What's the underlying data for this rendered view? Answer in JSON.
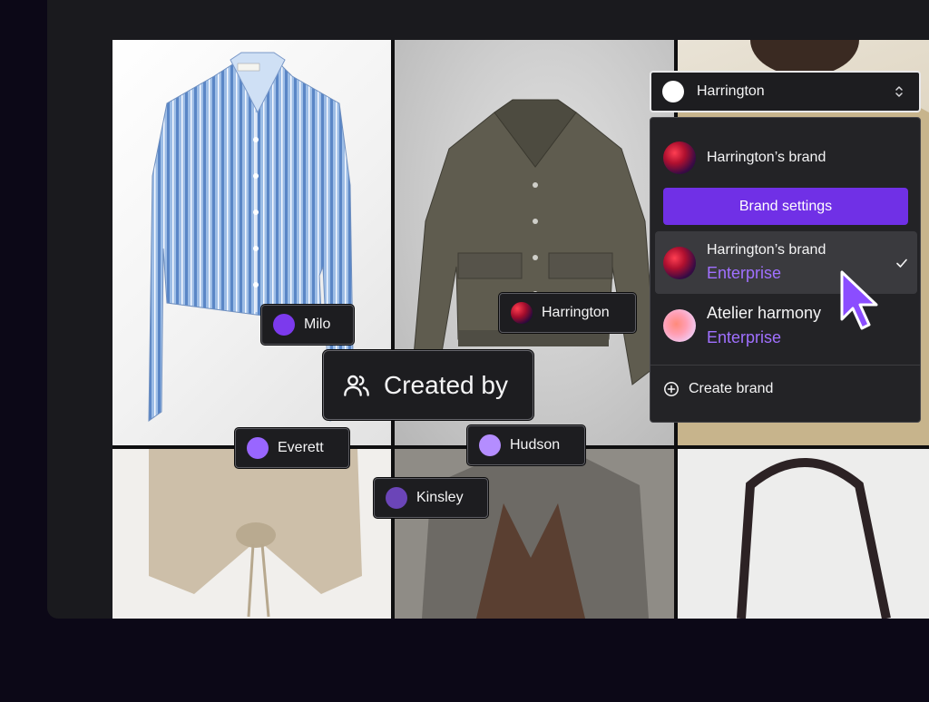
{
  "colors": {
    "accent": "#7030e6",
    "tier_text": "#a070ff",
    "chip_bg": "#1d1d20",
    "page_bg": "#0c0817"
  },
  "chips": [
    {
      "label": "Milo",
      "dot_color": "#7c3aed"
    },
    {
      "label": "Harrington",
      "avatar": "brand-avatar"
    },
    {
      "label": "Everett",
      "dot_color": "#9966ff"
    },
    {
      "label": "Hudson",
      "dot_color": "#b48dff"
    },
    {
      "label": "Kinsley",
      "dot_color": "#6b45b8"
    }
  ],
  "filter": {
    "label": "Created by",
    "icon": "users-icon"
  },
  "brand_selector": {
    "selected_label": "Harrington",
    "icon": "chevron-up-down-icon"
  },
  "dropdown": {
    "header_name": "Harrington’s brand",
    "settings_label": "Brand settings",
    "items": [
      {
        "name": "Harrington’s brand",
        "tier": "Enterprise",
        "selected": true
      },
      {
        "name": "Atelier harmony",
        "tier": "Enterprise",
        "selected": false
      }
    ],
    "create_label": "Create brand",
    "create_icon": "plus-circle-icon"
  }
}
